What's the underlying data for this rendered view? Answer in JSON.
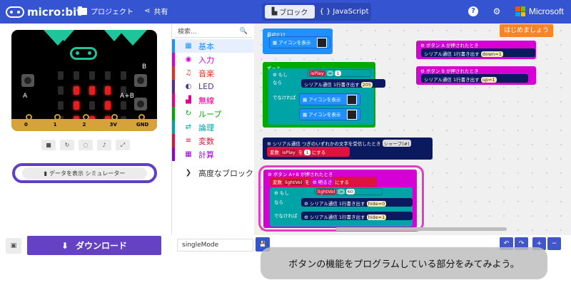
{
  "app": {
    "name": "micro:bit",
    "projects": "プロジェクト",
    "share": "共有",
    "microsoft": "Microsoft"
  },
  "mode_tabs": {
    "blocks": "ブロック",
    "javascript": "JavaScript"
  },
  "simulator": {
    "pins": [
      "0",
      "1",
      "2",
      "3V",
      "GND"
    ],
    "btn_a": "A",
    "btn_b": "B",
    "btn_ab": "A+B",
    "data_button": "データを表示 シミュレーター",
    "download": "ダウンロード",
    "led_matrix": [
      [
        0,
        0,
        0,
        0,
        0
      ],
      [
        0,
        1,
        1,
        1,
        0
      ],
      [
        0,
        1,
        0,
        1,
        0
      ],
      [
        0,
        1,
        1,
        1,
        0
      ],
      [
        0,
        1,
        0,
        1,
        0
      ]
    ]
  },
  "toolbox": {
    "search_placeholder": "検索...",
    "categories": [
      {
        "label": "基本",
        "color": "#1e90ff"
      },
      {
        "label": "入力",
        "color": "#d400d4"
      },
      {
        "label": "音楽",
        "color": "#e63022"
      },
      {
        "label": "LED",
        "color": "#5c2d91"
      },
      {
        "label": "無線",
        "color": "#e3008c"
      },
      {
        "label": "ループ",
        "color": "#00aa00"
      },
      {
        "label": "論理",
        "color": "#00a4a6"
      },
      {
        "label": "変数",
        "color": "#dc143c"
      },
      {
        "label": "計算",
        "color": "#9400d3"
      },
      {
        "label": "高度なブロック",
        "color": "#333333"
      }
    ]
  },
  "blocks": {
    "on_start": "最初だけ",
    "show_icon": "アイコンを表示",
    "forever": "ずっと",
    "if": "もし",
    "then": "なら",
    "else": "でなければ",
    "var_isPlay": "isPlay",
    "eq": "=",
    "one": "1",
    "serial_writeline": "シリアル通信 1行書き出す",
    "val_205": "205",
    "on_serial": "シリアル通信 つぎのいずれかの文字を受信したとき",
    "sharp": "シャープ(#)",
    "set_var": "変数",
    "to": "を",
    "set_to": "にする",
    "val_1": "1",
    "btn_A_pressed": "ボタン A が押されたとき",
    "btn_B_pressed": "ボタン B が押されたとき",
    "down1": "down=1",
    "up1": "up=1",
    "btn_AB_pressed": "ボタン A+B が押されたとき",
    "lightVol": "lightVol",
    "brightness": "明るさ",
    "gt": ">",
    "val_60": "60",
    "hide0": "hide=0",
    "hide1": "hide=1",
    "btn_A": "A",
    "btn_B": "B",
    "btn_AB": "A+B"
  },
  "getting_started": "はじめましょう",
  "project_name": "singleMode",
  "caption": "ボタンの機能をプログラムしている部分をみてみよう。"
}
